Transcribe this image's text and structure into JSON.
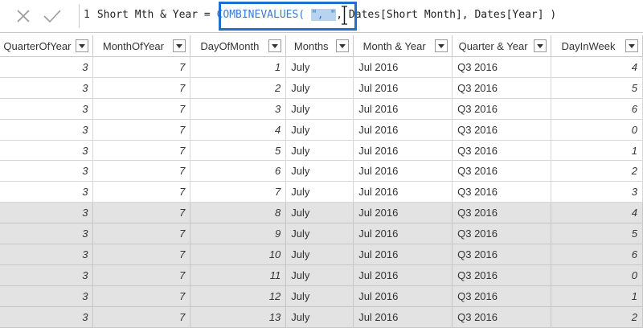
{
  "formula": {
    "line_number": "1",
    "measure_name": "Short Mth & Year = ",
    "function": "COMBINEVALUES(",
    "space": " ",
    "selected_arg": "\", \"",
    "rest": ", Dates[Short Month], Dates[Year] )",
    "cancel_icon": "close-icon",
    "commit_icon": "check-icon",
    "highlight_color": "#1e6fd0"
  },
  "table": {
    "columns": [
      "QuarterOfYear",
      "MonthOfYear",
      "DayOfMonth",
      "Months",
      "Month & Year",
      "Quarter & Year",
      "DayInWeek"
    ],
    "rows": [
      [
        "3",
        "7",
        "1",
        "July",
        "Jul 2016",
        "Q3 2016",
        "4"
      ],
      [
        "3",
        "7",
        "2",
        "July",
        "Jul 2016",
        "Q3 2016",
        "5"
      ],
      [
        "3",
        "7",
        "3",
        "July",
        "Jul 2016",
        "Q3 2016",
        "6"
      ],
      [
        "3",
        "7",
        "4",
        "July",
        "Jul 2016",
        "Q3 2016",
        "0"
      ],
      [
        "3",
        "7",
        "5",
        "July",
        "Jul 2016",
        "Q3 2016",
        "1"
      ],
      [
        "3",
        "7",
        "6",
        "July",
        "Jul 2016",
        "Q3 2016",
        "2"
      ],
      [
        "3",
        "7",
        "7",
        "July",
        "Jul 2016",
        "Q3 2016",
        "3"
      ],
      [
        "3",
        "7",
        "8",
        "July",
        "Jul 2016",
        "Q3 2016",
        "4"
      ],
      [
        "3",
        "7",
        "9",
        "July",
        "Jul 2016",
        "Q3 2016",
        "5"
      ],
      [
        "3",
        "7",
        "10",
        "July",
        "Jul 2016",
        "Q3 2016",
        "6"
      ],
      [
        "3",
        "7",
        "11",
        "July",
        "Jul 2016",
        "Q3 2016",
        "0"
      ],
      [
        "3",
        "7",
        "12",
        "July",
        "Jul 2016",
        "Q3 2016",
        "1"
      ],
      [
        "3",
        "7",
        "13",
        "July",
        "Jul 2016",
        "Q3 2016",
        "2"
      ]
    ]
  }
}
